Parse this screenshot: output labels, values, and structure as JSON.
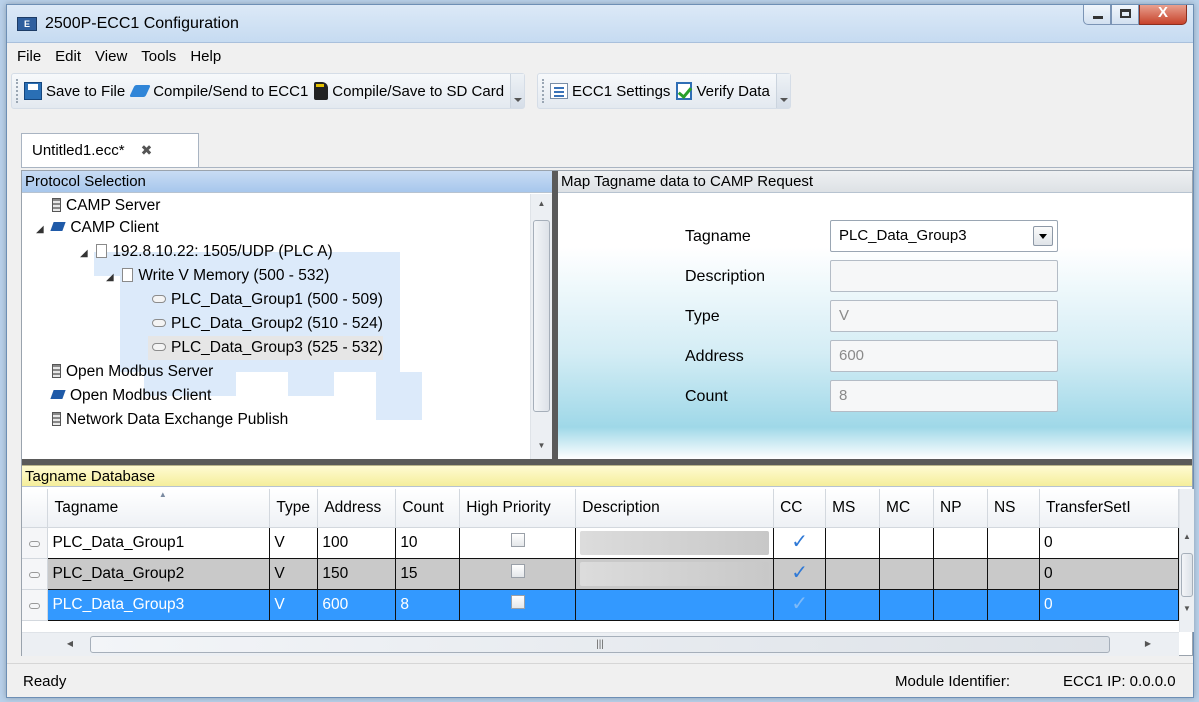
{
  "window": {
    "title": "2500P-ECC1 Configuration",
    "icon": "app-icon",
    "close_glyph": "X"
  },
  "menu": [
    "File",
    "Edit",
    "View",
    "Tools",
    "Help"
  ],
  "toolbar": {
    "save": "Save to File",
    "compile_send": "Compile/Send to ECC1",
    "compile_sd": "Compile/Save to SD Card",
    "settings": "ECC1 Settings",
    "verify": "Verify Data"
  },
  "tab": {
    "label": "Untitled1.ecc*",
    "close": "✖"
  },
  "protocol_pane": {
    "header": "Protocol Selection",
    "nodes": [
      {
        "label": "CAMP Server",
        "icon": "server-icon"
      },
      {
        "label": "CAMP Client",
        "icon": "client-icon"
      },
      {
        "label": "192.8.10.22: 1505/UDP (PLC A)",
        "icon": "document-icon"
      },
      {
        "label": "Write V Memory (500 - 532)",
        "icon": "document-icon"
      },
      {
        "label": "PLC_Data_Group1 (500 - 509)",
        "icon": "tag-icon"
      },
      {
        "label": "PLC_Data_Group2 (510 - 524)",
        "icon": "tag-icon"
      },
      {
        "label": "PLC_Data_Group3 (525 - 532)",
        "icon": "tag-icon"
      },
      {
        "label": "Open Modbus Server",
        "icon": "server-icon"
      },
      {
        "label": "Open Modbus Client",
        "icon": "client-icon"
      },
      {
        "label": "Network Data Exchange Publish",
        "icon": "server-icon"
      }
    ],
    "expander": "◢"
  },
  "map_pane": {
    "header": "Map Tagname data to CAMP Request",
    "fields": {
      "tagname": {
        "label": "Tagname",
        "value": "PLC_Data_Group3"
      },
      "description": {
        "label": "Description",
        "value": ""
      },
      "type": {
        "label": "Type",
        "value": "V"
      },
      "address": {
        "label": "Address",
        "value": "600"
      },
      "count": {
        "label": "Count",
        "value": "8"
      }
    }
  },
  "database": {
    "header": "Tagname Database",
    "columns": [
      "Tagname",
      "Type",
      "Address",
      "Count",
      "High Priority",
      "Description",
      "CC",
      "MS",
      "MC",
      "NP",
      "NS",
      "TransferSetI"
    ],
    "rows": [
      {
        "tagname": "PLC_Data_Group1",
        "type": "V",
        "address": "100",
        "count": "10",
        "high_priority": false,
        "description": "",
        "cc": "✓",
        "transfer": "0"
      },
      {
        "tagname": "PLC_Data_Group2",
        "type": "V",
        "address": "150",
        "count": "15",
        "high_priority": false,
        "description": "",
        "cc": "✓",
        "transfer": "0"
      },
      {
        "tagname": "PLC_Data_Group3",
        "type": "V",
        "address": "600",
        "count": "8",
        "high_priority": false,
        "description": "",
        "cc": "✓",
        "transfer": "0"
      }
    ],
    "scroll_grip": "|||"
  },
  "status": {
    "left": "Ready",
    "module_identifier": "Module Identifier:",
    "ip": "ECC1 IP: 0.0.0.0"
  },
  "colors": {
    "selection": "#3399ff",
    "protocol_header": "#a7c7ec",
    "db_header": "#f5ee9b",
    "splitter": "#5a5a5a"
  }
}
